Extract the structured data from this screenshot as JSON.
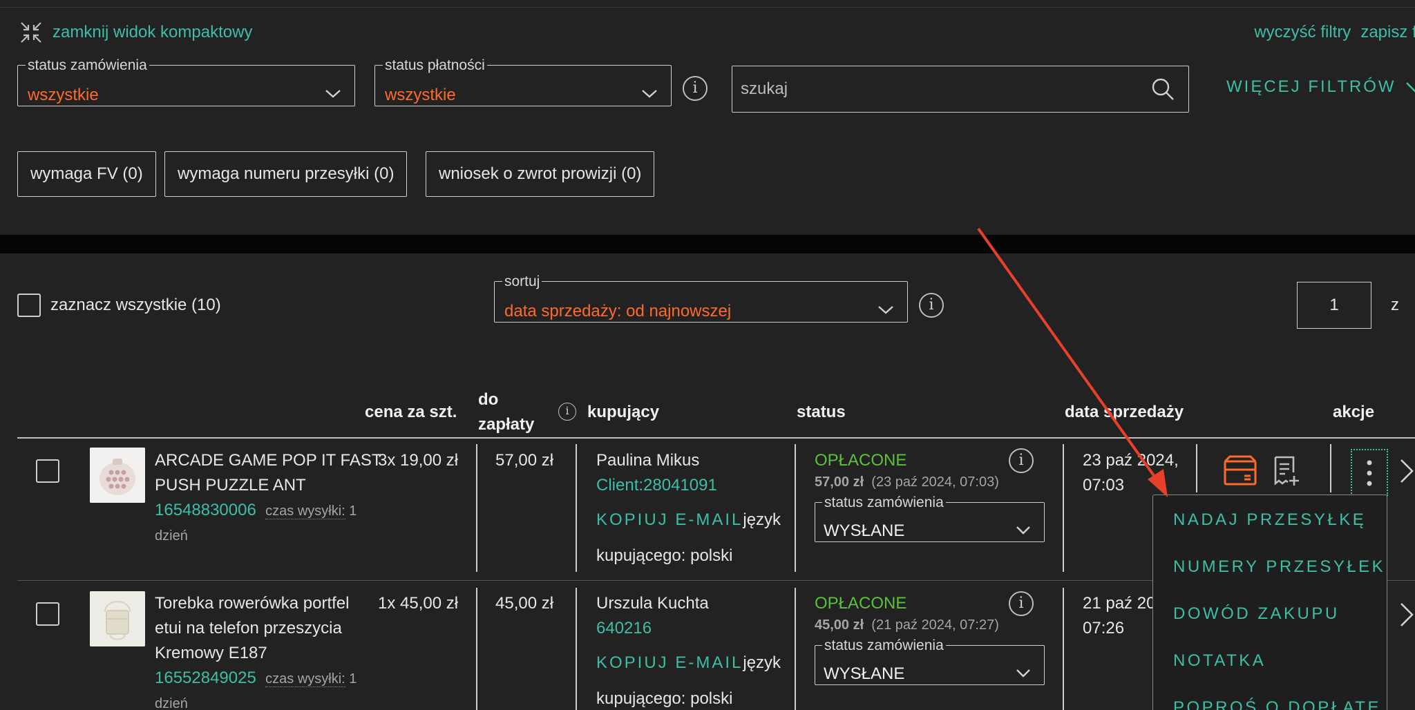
{
  "top": {
    "compact_label": "zamknij widok kompaktowy",
    "clear_filters": "wyczyść filtry",
    "save_filters": "zapisz filtry"
  },
  "filters": {
    "order_status": {
      "label": "status zamówienia",
      "value": "wszystkie"
    },
    "payment_status": {
      "label": "status płatności",
      "value": "wszystkie"
    },
    "info_glyph": "i",
    "search_placeholder": "szukaj",
    "more_filters": "WIĘCEJ FILTRÓW",
    "chips": [
      "wymaga FV (0)",
      "wymaga numeru przesyłki (0)",
      "wniosek o zwrot prowizji (0)"
    ]
  },
  "list": {
    "select_all": "zaznacz wszystkie (10)",
    "sort": {
      "label": "sortuj",
      "value": "data sprzedaży: od najnowszej"
    },
    "page": "1",
    "page_of": "z"
  },
  "table": {
    "headers": {
      "price": "cena za szt.",
      "to_pay_1": "do",
      "to_pay_2": "zapłaty",
      "buyer": "kupujący",
      "status": "status",
      "sale_date": "data sprzedaży",
      "actions": "akcje"
    },
    "rows": [
      {
        "title_1": "ARCADE GAME POP IT FAST",
        "title_2": "PUSH PUZZLE ANT",
        "offer_id": "16548830006",
        "ship_label": "czas wysyłki:",
        "ship_value": " 1",
        "ship_unit": "dzień",
        "qty_price": "3x 19,00 zł",
        "to_pay": "57,00 zł",
        "buyer_name": "Paulina Mikus",
        "buyer_login": "Client:28041091",
        "copy_email": "KOPIUJ E-MAIL",
        "lang_1": "język",
        "lang_2": "kupującego: polski",
        "payment_status": "OPŁACONE",
        "paid_amount": "57,00 zł",
        "paid_date": "(23 paź 2024, 07:03)",
        "order_status_label": "status zamówienia",
        "order_status_value": "WYSŁANE",
        "date_1": "23 paź 2024,",
        "date_2": "07:03"
      },
      {
        "title_1": "Torebka rowerówka portfel",
        "title_2": "etui na telefon przeszycia",
        "title_3": "Kremowy E187",
        "offer_id": "16552849025",
        "ship_label": "czas wysyłki:",
        "ship_value": " 1",
        "ship_unit": "dzień",
        "qty_price": "1x 45,00 zł",
        "to_pay": "45,00 zł",
        "buyer_name": "Urszula Kuchta",
        "buyer_login": "640216",
        "copy_email": "KOPIUJ E-MAIL",
        "lang_1": "język",
        "lang_2": "kupującego: polski",
        "payment_status": "OPŁACONE",
        "paid_amount": "45,00 zł",
        "paid_date": "(21 paź 2024, 07:27)",
        "order_status_label": "status zamówienia",
        "order_status_value": "WYSŁANE",
        "date_1": "21 paź 20",
        "date_2": "07:26"
      }
    ]
  },
  "actions_menu": {
    "items": [
      "NADAJ PRZESYŁKĘ",
      "NUMERY PRZESYŁEK",
      "DOWÓD ZAKUPU",
      "NOTATKA",
      "POPROŚ O DOPŁATĘ"
    ]
  },
  "colors": {
    "background": "#222222",
    "accent": "#3dbfa6",
    "highlight": "#ff6a2b",
    "paid": "#5cc13c",
    "annotation_arrow": "#e8402a"
  }
}
